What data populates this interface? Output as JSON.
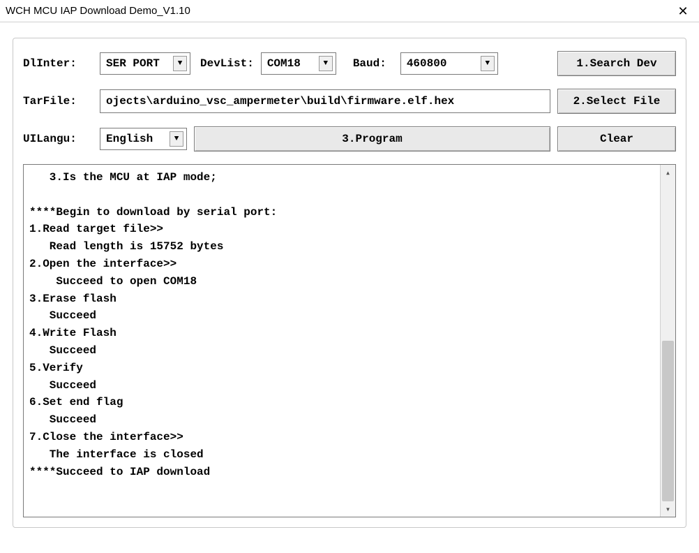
{
  "window": {
    "title": "WCH MCU IAP Download Demo_V1.10"
  },
  "row1": {
    "dlinter_label": "DlInter:",
    "dlinter_value": "SER PORT",
    "devlist_label": "DevList:",
    "devlist_value": "COM18",
    "baud_label": "Baud:",
    "baud_value": "460800",
    "search_btn": "1.Search Dev"
  },
  "row2": {
    "tarfile_label": "TarFile:",
    "tarfile_value": "ojects\\arduino_vsc_ampermeter\\build\\firmware.elf.hex",
    "select_file_btn": "2.Select File"
  },
  "row3": {
    "uilangu_label": "UILangu:",
    "uilangu_value": "English",
    "program_btn": "3.Program",
    "clear_btn": "Clear"
  },
  "log_text": "   3.Is the MCU at IAP mode;\n\n****Begin to download by serial port:\n1.Read target file>>\n   Read length is 15752 bytes\n2.Open the interface>>\n    Succeed to open COM18\n3.Erase flash\n   Succeed\n4.Write Flash\n   Succeed\n5.Verify\n   Succeed\n6.Set end flag\n   Succeed\n7.Close the interface>>\n   The interface is closed\n****Succeed to IAP download"
}
